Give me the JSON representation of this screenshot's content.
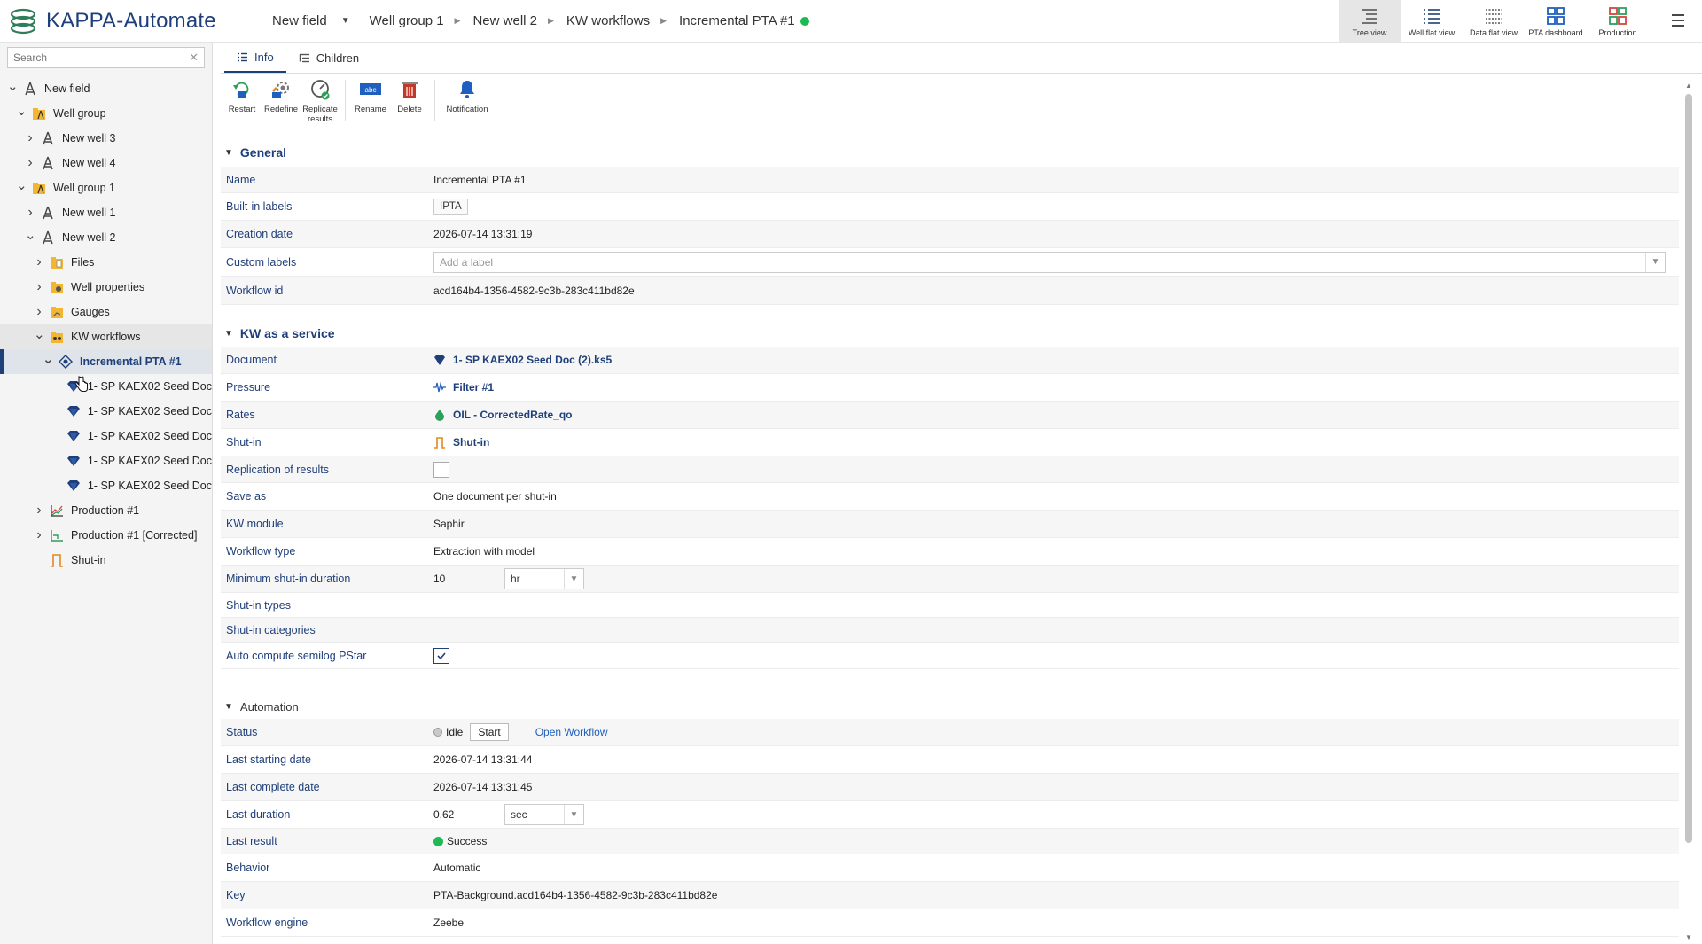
{
  "app": {
    "title": "KAPPA-Automate"
  },
  "breadcrumb": [
    "New field",
    "Well group 1",
    "New well 2",
    "KW workflows",
    "Incremental PTA #1"
  ],
  "views": [
    {
      "label": "Tree view",
      "icon": "tree-view-icon",
      "active": true
    },
    {
      "label": "Well flat view",
      "icon": "well-flat-view-icon",
      "active": false
    },
    {
      "label": "Data flat view",
      "icon": "data-flat-view-icon",
      "active": false
    },
    {
      "label": "PTA dashboard",
      "icon": "pta-dashboard-icon",
      "active": false
    },
    {
      "label": "Production",
      "icon": "production-icon",
      "active": false
    }
  ],
  "sidebar": {
    "search_placeholder": "Search",
    "tree": [
      {
        "label": "New field",
        "level": 0,
        "toggle": "open",
        "icon": "field-icon"
      },
      {
        "label": "Well group",
        "level": 1,
        "toggle": "open",
        "icon": "well-group-icon"
      },
      {
        "label": "New well 3",
        "level": 2,
        "toggle": "closed",
        "icon": "well-icon"
      },
      {
        "label": "New well 4",
        "level": 2,
        "toggle": "closed",
        "icon": "well-icon"
      },
      {
        "label": "Well group 1",
        "level": 1,
        "toggle": "open",
        "icon": "well-group-icon"
      },
      {
        "label": "New well 1",
        "level": 2,
        "toggle": "closed",
        "icon": "well-icon"
      },
      {
        "label": "New well 2",
        "level": 2,
        "toggle": "open",
        "icon": "well-icon"
      },
      {
        "label": "Files",
        "level": 3,
        "toggle": "closed",
        "icon": "files-folder-icon"
      },
      {
        "label": "Well properties",
        "level": 3,
        "toggle": "closed",
        "icon": "well-properties-icon"
      },
      {
        "label": "Gauges",
        "level": 3,
        "toggle": "closed",
        "icon": "gauges-folder-icon"
      },
      {
        "label": "KW workflows",
        "level": 3,
        "toggle": "open",
        "icon": "kw-workflows-icon"
      },
      {
        "label": "Incremental PTA #1",
        "level": 4,
        "toggle": "open",
        "icon": "workflow-icon"
      },
      {
        "label": "1- SP KAEX02 Seed Doc",
        "level": 5,
        "toggle": "none",
        "icon": "document-gem-icon"
      },
      {
        "label": "1- SP KAEX02 Seed Doc",
        "level": 5,
        "toggle": "none",
        "icon": "document-gem-icon"
      },
      {
        "label": "1- SP KAEX02 Seed Doc",
        "level": 5,
        "toggle": "none",
        "icon": "document-gem-icon"
      },
      {
        "label": "1- SP KAEX02 Seed Doc",
        "level": 5,
        "toggle": "none",
        "icon": "document-gem-icon"
      },
      {
        "label": "1- SP KAEX02 Seed Doc",
        "level": 5,
        "toggle": "none",
        "icon": "document-gem-icon"
      },
      {
        "label": "Production #1",
        "level": 3,
        "toggle": "closed",
        "icon": "production-chart-icon"
      },
      {
        "label": "Production #1 [Corrected]",
        "level": 3,
        "toggle": "closed",
        "icon": "production-corrected-icon"
      },
      {
        "label": "Shut-in",
        "level": 3,
        "toggle": "none",
        "icon": "shut-in-icon"
      }
    ]
  },
  "tabs": [
    {
      "label": "Info",
      "active": true
    },
    {
      "label": "Children",
      "active": false
    }
  ],
  "toolbar": {
    "restart": "Restart",
    "redefine": "Redefine",
    "replicate": "Replicate results",
    "rename": "Rename",
    "delete": "Delete",
    "notification": "Notification"
  },
  "sections": {
    "general": "General",
    "kw_service": "KW as a service",
    "automation": "Automation"
  },
  "general": {
    "name_label": "Name",
    "name": "Incremental PTA #1",
    "builtin_label": "Built-in labels",
    "builtin": "IPTA",
    "creation_label": "Creation date",
    "creation": "2026-07-14 13:31:19",
    "custom_label": "Custom labels",
    "custom_placeholder": "Add a label",
    "workflow_id_label": "Workflow id",
    "workflow_id": "acd164b4-1356-4582-9c3b-283c411bd82e"
  },
  "kw": {
    "document_label": "Document",
    "document": "1- SP KAEX02 Seed Doc (2).ks5",
    "pressure_label": "Pressure",
    "pressure": "Filter #1",
    "rates_label": "Rates",
    "rates": "OIL - CorrectedRate_qo",
    "shutin_label": "Shut-in",
    "shutin": "Shut-in",
    "replication_label": "Replication of results",
    "replication_checked": false,
    "save_as_label": "Save as",
    "save_as": "One document per shut-in",
    "module_label": "KW module",
    "module": "Saphir",
    "workflow_type_label": "Workflow type",
    "workflow_type": "Extraction with model",
    "min_duration_label": "Minimum shut-in duration",
    "min_duration": "10",
    "min_duration_unit": "hr",
    "shutin_types_label": "Shut-in types",
    "shutin_categories_label": "Shut-in categories",
    "auto_pstar_label": "Auto compute semilog PStar",
    "auto_pstar_checked": true
  },
  "automation": {
    "status_label": "Status",
    "status": "Idle",
    "start": "Start",
    "open": "Open Workflow",
    "last_start_label": "Last starting date",
    "last_start": "2026-07-14 13:31:44",
    "last_complete_label": "Last complete date",
    "last_complete": "2026-07-14 13:31:45",
    "last_duration_label": "Last duration",
    "last_duration": "0.62",
    "last_duration_unit": "sec",
    "last_result_label": "Last result",
    "last_result": "Success",
    "behavior_label": "Behavior",
    "behavior": "Automatic",
    "key_label": "Key",
    "key": "PTA-Background.acd164b4-1356-4582-9c3b-283c411bd82e",
    "engine_label": "Workflow engine",
    "engine": "Zeebe"
  },
  "colors": {
    "brand": "#1f3f7a",
    "status_green": "#1db954",
    "idle_gray": "#c9c9c9"
  }
}
